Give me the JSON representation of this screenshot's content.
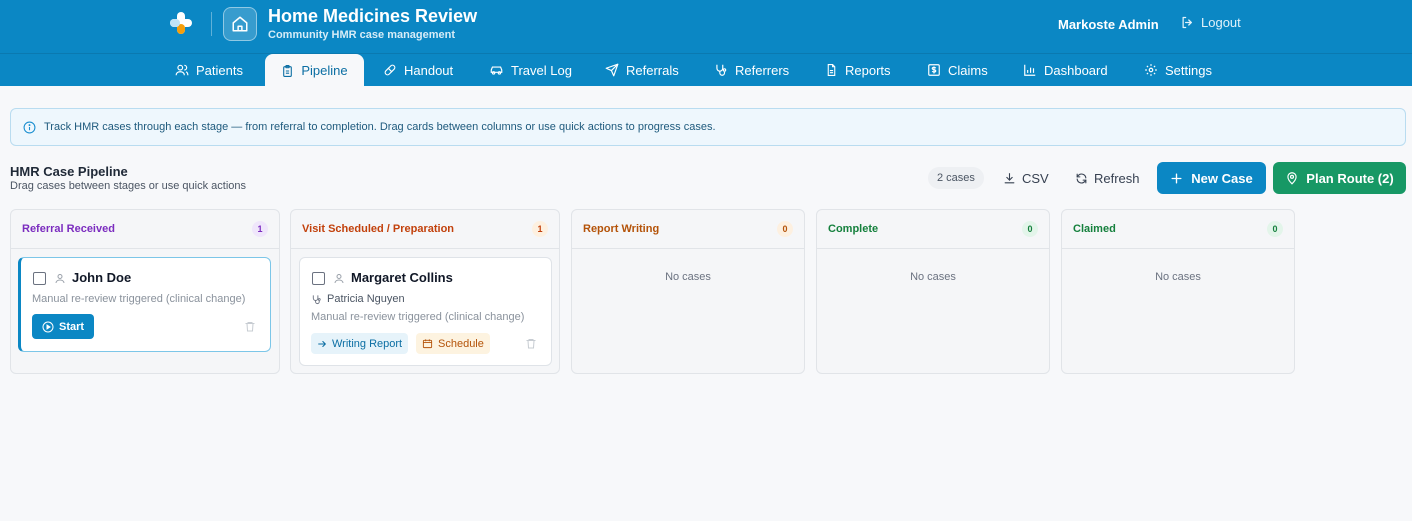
{
  "app": {
    "title": "Home Medicines Review",
    "subtitle": "Community HMR case management",
    "user": "Markoste Admin",
    "logout_label": "Logout"
  },
  "nav": {
    "tabs": [
      {
        "label": "Patients",
        "icon": "users-icon"
      },
      {
        "label": "Pipeline",
        "icon": "clipboard-icon",
        "active": true
      },
      {
        "label": "Handout",
        "icon": "pill-icon"
      },
      {
        "label": "Travel Log",
        "icon": "car-icon"
      },
      {
        "label": "Referrals",
        "icon": "send-icon"
      },
      {
        "label": "Referrers",
        "icon": "stethoscope-icon"
      },
      {
        "label": "Reports",
        "icon": "document-icon"
      },
      {
        "label": "Claims",
        "icon": "dollar-icon"
      },
      {
        "label": "Dashboard",
        "icon": "bar-chart-icon"
      },
      {
        "label": "Settings",
        "icon": "gear-icon"
      }
    ]
  },
  "info": {
    "text": "Track HMR cases through each stage — from referral to completion. Drag cards between columns or use quick actions to progress cases."
  },
  "pipeline": {
    "title": "HMR Case Pipeline",
    "subtitle": "Drag cases between stages or use quick actions",
    "count_label": "2 cases",
    "csv_label": "CSV",
    "refresh_label": "Refresh",
    "new_case_label": "New Case",
    "plan_route_label": "Plan Route (2)"
  },
  "columns": [
    {
      "title": "Referral Received",
      "count": "1",
      "color": "#7b2cbf",
      "badge_bg": "#efe6fb"
    },
    {
      "title": "Visit Scheduled / Preparation",
      "count": "1",
      "color": "#c2410c",
      "badge_bg": "#fdf0e0"
    },
    {
      "title": "Report Writing",
      "count": "0",
      "color": "#b45309",
      "badge_bg": "#fdf0e0",
      "empty": "No cases"
    },
    {
      "title": "Complete",
      "count": "0",
      "color": "#15803d",
      "badge_bg": "#e3f5ea",
      "empty": "No cases"
    },
    {
      "title": "Claimed",
      "count": "0",
      "color": "#15803d",
      "badge_bg": "#e3f5ea",
      "empty": "No cases"
    }
  ],
  "cards": {
    "john": {
      "name": "John Doe",
      "note": "Manual re-review triggered (clinical change)",
      "start_label": "Start"
    },
    "margaret": {
      "name": "Margaret Collins",
      "referrer": "Patricia Nguyen",
      "note": "Manual re-review triggered (clinical change)",
      "writing_label": "Writing Report",
      "schedule_label": "Schedule"
    }
  }
}
